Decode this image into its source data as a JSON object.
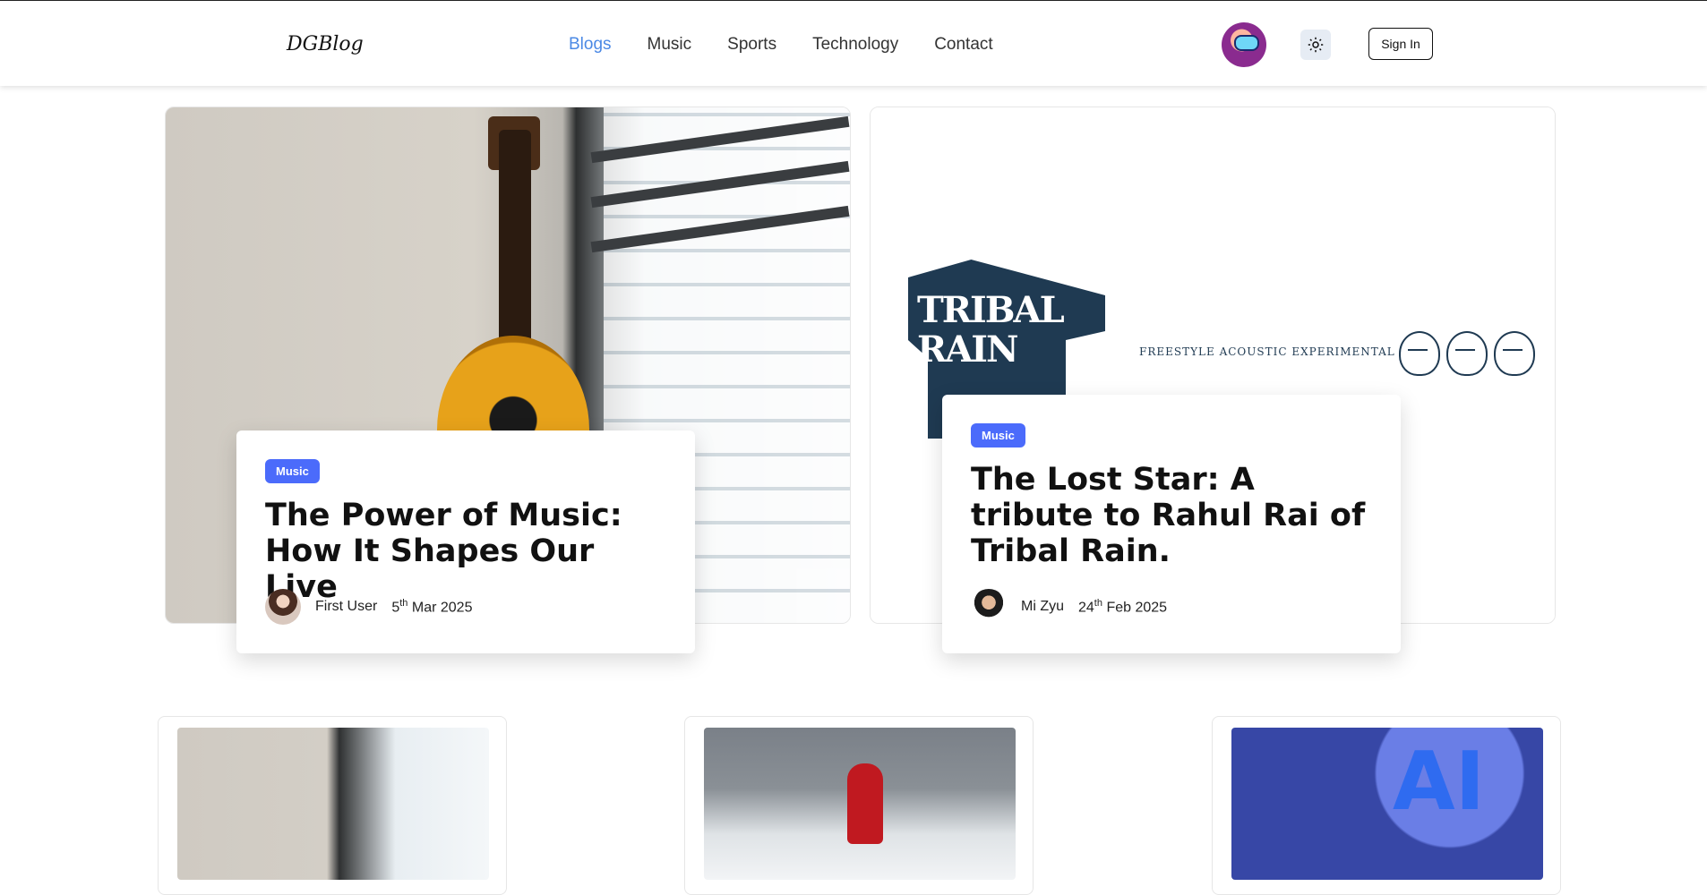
{
  "header": {
    "logo": "DGBlog",
    "nav": [
      "Blogs",
      "Music",
      "Sports",
      "Technology",
      "Contact"
    ],
    "active_nav": "Blogs",
    "theme_icon": "sun-icon",
    "signin_label": "Sign In"
  },
  "featured": [
    {
      "tag": "Music",
      "title": "The Power of Music: How It Shapes Our Live",
      "author": "First User",
      "date_day": "5",
      "date_suffix": "th",
      "date_rest": "Mar 2025"
    },
    {
      "tag": "Music",
      "title": "The Lost Star: A tribute to Rahul Rai of Tribal Rain.",
      "author": "Mi Zyu",
      "date_day": "24",
      "date_suffix": "th",
      "date_rest": "Feb 2025",
      "image_text": {
        "logo": "TRIBAL RAIN",
        "subtitle": "FREESTYLE ACOUSTIC EXPERIMENTAL"
      }
    }
  ],
  "colors": {
    "accent": "#4b89e5",
    "tag": "#4b6bfb"
  }
}
